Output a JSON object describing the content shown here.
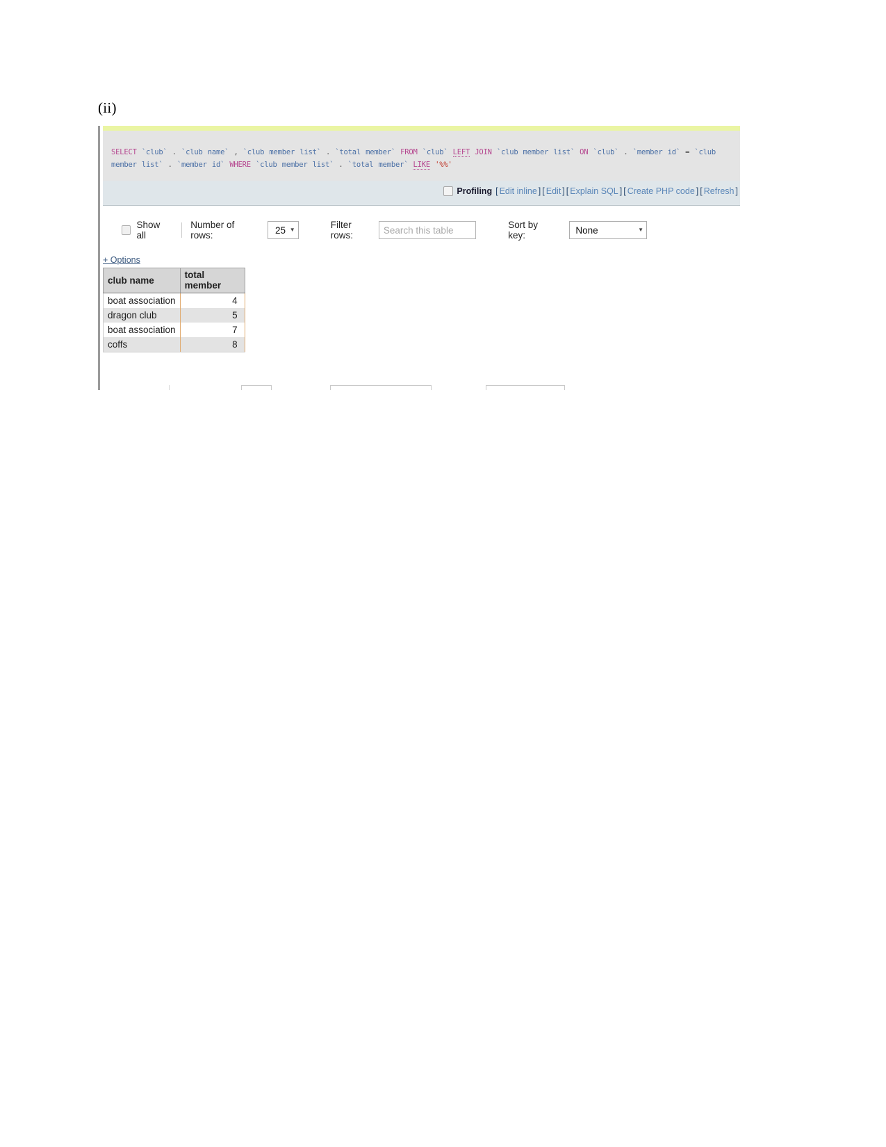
{
  "document": {
    "section_label": "(ii)"
  },
  "sql": {
    "tokens": [
      {
        "t": "SELECT",
        "k": "kw"
      },
      {
        "t": "`club`",
        "k": "ident"
      },
      {
        "t": ".",
        "k": "punct"
      },
      {
        "t": "`club name`",
        "k": "ident"
      },
      {
        "t": ",",
        "k": "punct"
      },
      {
        "t": "`club member list`",
        "k": "ident"
      },
      {
        "t": ".",
        "k": "punct"
      },
      {
        "t": "`total member`",
        "k": "ident"
      },
      {
        "t": "FROM",
        "k": "kw"
      },
      {
        "t": "`club`",
        "k": "ident"
      },
      {
        "t": "LEFT",
        "k": "kw-u"
      },
      {
        "t": "JOIN",
        "k": "kw"
      },
      {
        "t": "`club member list`",
        "k": "ident"
      },
      {
        "t": "ON",
        "k": "kw"
      },
      {
        "t": "`club`",
        "k": "ident"
      },
      {
        "t": ".",
        "k": "punct"
      },
      {
        "t": "`member id`",
        "k": "ident"
      },
      {
        "t": "=",
        "k": "punct"
      },
      {
        "t": "`club member list`",
        "k": "ident"
      },
      {
        "t": ".",
        "k": "punct"
      },
      {
        "t": "`member id`",
        "k": "ident"
      },
      {
        "t": "WHERE",
        "k": "kw"
      },
      {
        "t": "`club member list`",
        "k": "ident"
      },
      {
        "t": ".",
        "k": "punct"
      },
      {
        "t": "`total member`",
        "k": "ident"
      },
      {
        "t": "LIKE",
        "k": "kw-u"
      },
      {
        "t": "'%%'",
        "k": "str"
      }
    ],
    "full_query": "SELECT `club`.`club name`, `club member list`.`total member` FROM `club` LEFT JOIN `club member list` ON `club`.`member id` = `club member list`.`member id` WHERE `club member list`.`total member` LIKE '%%'"
  },
  "actions": {
    "profiling_label": "Profiling",
    "edit_inline": "Edit inline",
    "edit": "Edit",
    "explain_sql": "Explain SQL",
    "create_php": "Create PHP code",
    "refresh": "Refresh",
    "bracket_open": "[",
    "bracket_close": "]"
  },
  "controls": {
    "show_all_label": "Show all",
    "number_of_rows_label": "Number of rows:",
    "number_of_rows_value": "25",
    "filter_rows_label": "Filter rows:",
    "filter_rows_placeholder": "Search this table",
    "sort_by_key_label": "Sort by key:",
    "sort_by_key_value": "None",
    "caret_glyph": "▼",
    "options_label": "+ Options"
  },
  "results": {
    "columns": [
      "club name",
      "total member"
    ],
    "rows": [
      {
        "club_name": "boat association",
        "total_member": "4"
      },
      {
        "club_name": "dragon club",
        "total_member": "5"
      },
      {
        "club_name": "boat association",
        "total_member": "7"
      },
      {
        "club_name": "coffs",
        "total_member": "8"
      }
    ]
  },
  "colors": {
    "sql_panel_bg": "#e4e4e4",
    "sql_top_accent": "#eaf5a3",
    "actions_bar_bg": "#dfe6ea",
    "link": "#5a86b8",
    "table_header_bg": "#d6d6d6",
    "row_alt_bg": "#e3e3e3",
    "cell_border_accent": "#e0a96d"
  }
}
